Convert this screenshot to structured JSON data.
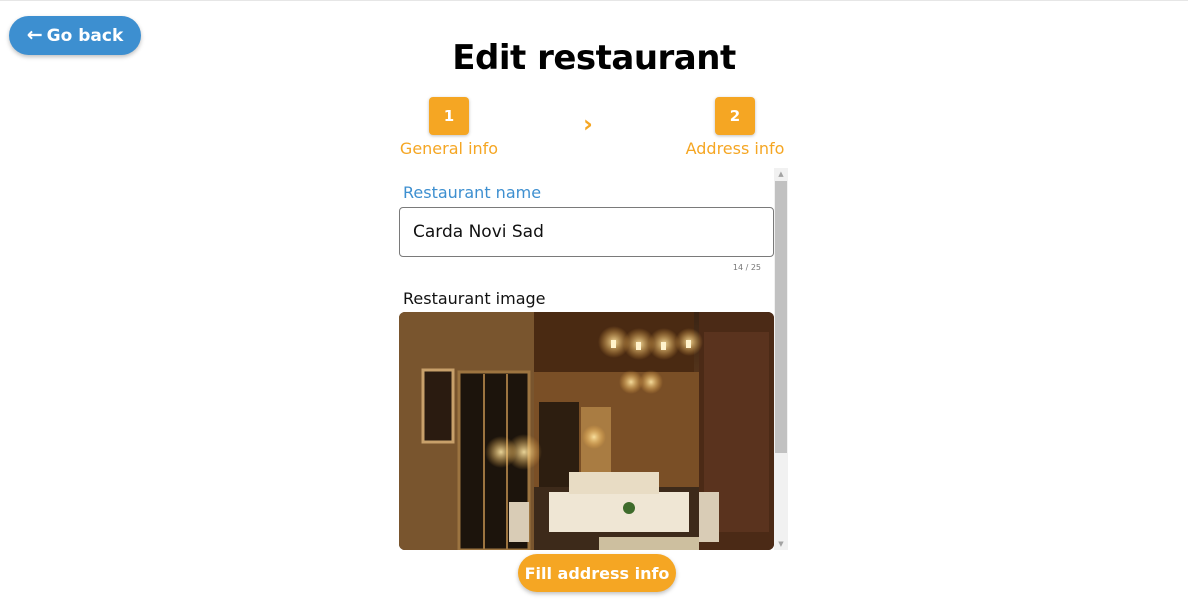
{
  "nav": {
    "back_label": "Go back",
    "back_icon": "arrow-left-icon"
  },
  "page": {
    "title": "Edit restaurant"
  },
  "stepper": {
    "steps": [
      {
        "number": "1",
        "label": "General info"
      },
      {
        "number": "2",
        "label": "Address info"
      }
    ],
    "separator_icon": "chevron-right-icon"
  },
  "form": {
    "name_label": "Restaurant name",
    "name_value": "Carda Novi Sad",
    "name_counter": "14 / 25",
    "image_label": "Restaurant image",
    "image_icon": "restaurant-photo"
  },
  "actions": {
    "next_label": "Fill address info"
  },
  "colors": {
    "primary": "#3d8fd0",
    "accent": "#f5a623"
  }
}
